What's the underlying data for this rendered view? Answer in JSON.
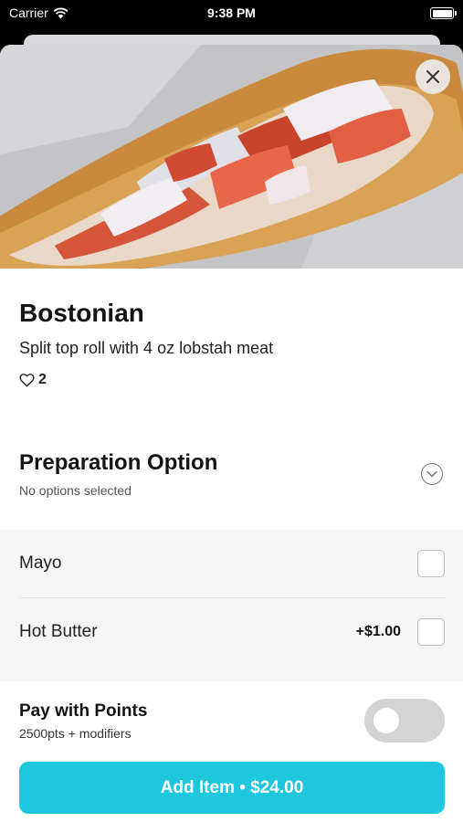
{
  "status_bar": {
    "carrier": "Carrier",
    "time": "9:38 PM"
  },
  "item": {
    "name": "Bostonian",
    "description": "Split top roll with 4 oz lobstah meat",
    "likes": "2"
  },
  "preparation": {
    "title": "Preparation Option",
    "subtitle": "No options selected",
    "options": [
      {
        "name": "Mayo",
        "price": "",
        "checked": false
      },
      {
        "name": "Hot Butter",
        "price": "+$1.00",
        "checked": false
      }
    ]
  },
  "points": {
    "title": "Pay with Points",
    "subtitle": "2500pts + modifiers",
    "enabled": false
  },
  "add_button": {
    "label": "Add Item • $24.00"
  },
  "colors": {
    "accent": "#1ec6de"
  }
}
